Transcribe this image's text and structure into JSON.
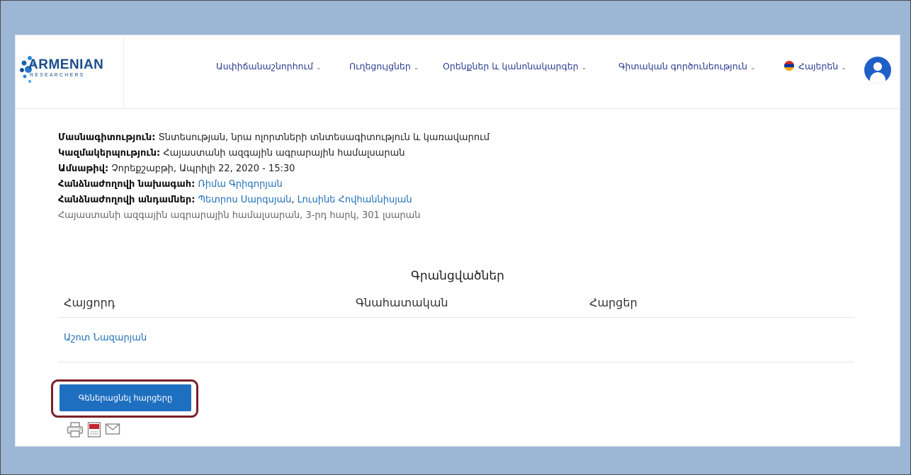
{
  "header": {
    "logo_main": "ARMENIAN",
    "logo_sub": "RESEARCHERS",
    "nav": [
      {
        "label": "Ասփիճանաշնորհում"
      },
      {
        "label": "Ուղեցույցներ"
      },
      {
        "label": "Օրենքներ և կանոնակարգեր"
      },
      {
        "label": "Գիտական գործունեություն"
      },
      {
        "label": "Հայերեն"
      }
    ]
  },
  "details": {
    "specialty_label": "Մասնագիտություն:",
    "specialty_value": "Տնտեսության, նրա ոլորտների տնտեսագիտություն և կառավարում",
    "organization_label": "Կազմակերպություն:",
    "organization_value": "Հայաստանի ազգային ագրարային համալսարան",
    "date_label": "Ամսաթիվ:",
    "date_value": "Չորեքշաբթի, Ապրիլի 22, 2020 - 15:30",
    "chair_label": "Հանձնաժողովի նախագահ:",
    "chair_value": "Ռիմա Գրիգորյան",
    "members_label": "Հանձնաժողովի անդամներ:",
    "member_1": "Պետրոս Սարգսյան",
    "member_sep": ",",
    "member_2": "Լուսինե Հովհաննիսյան",
    "location": "Հայաստանի ազգային ագրարային համալսարան, 3-րդ հարկ, 301 լսարան"
  },
  "registrations": {
    "title": "Գրանցվածներ",
    "columns": [
      "Հայցորդ",
      "Գնահատական",
      "Հարցեր"
    ],
    "rows": [
      {
        "applicant": "Աշոտ Նազարյան",
        "grade": "",
        "questions": ""
      }
    ]
  },
  "actions": {
    "generate_label": "Գեներացնել հարցերը"
  },
  "colors": {
    "accent": "#1f6fc1",
    "link": "#1f6fb7",
    "outline": "#7a1f2a",
    "frame_bg": "#9cb6d6"
  }
}
